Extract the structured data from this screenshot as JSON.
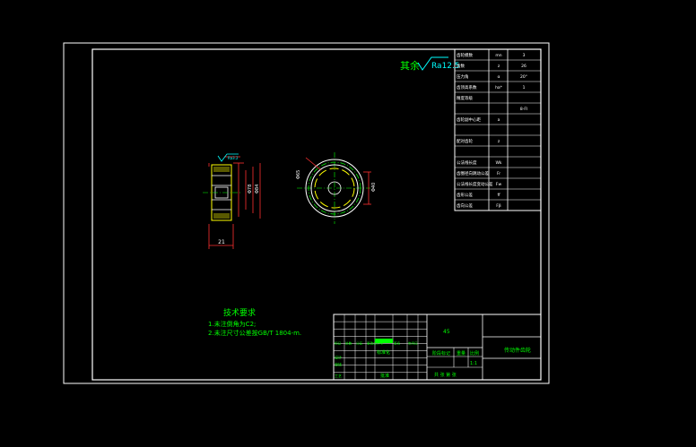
{
  "roughness": {
    "prefix": "其余",
    "value": "Ra12.5"
  },
  "tech_requirements": {
    "title": "技术要求",
    "items": [
      "1.未注倒角为C2;",
      "2.未注尺寸公差按GB/T 1804-m."
    ]
  },
  "params_table": {
    "rows": [
      {
        "name": "齿轮模数",
        "symbol": "mn",
        "value": "3"
      },
      {
        "name": "齿数",
        "symbol": "z",
        "value": "26"
      },
      {
        "name": "压力角",
        "symbol": "α",
        "value": "20°"
      },
      {
        "name": "齿顶高系数",
        "symbol": "ha*",
        "value": "1"
      },
      {
        "name": "精度等级",
        "symbol": "",
        "value": ""
      },
      {
        "name": "",
        "symbol": "",
        "value": "8-Fl"
      },
      {
        "name": "齿轮副中心距",
        "symbol": "a",
        "value": ""
      },
      {
        "name": "",
        "symbol": "",
        "value": ""
      },
      {
        "name": "配对齿轮",
        "symbol": "z",
        "value": ""
      },
      {
        "name": "",
        "symbol": "",
        "value": ""
      },
      {
        "name": "公法线长度",
        "symbol": "Wk",
        "value": ""
      },
      {
        "name": "齿圈径向跳动公差",
        "symbol": "Fr",
        "value": ""
      },
      {
        "name": "公法线长度变动公差",
        "symbol": "Fw",
        "value": ""
      },
      {
        "name": "齿形公差",
        "symbol": "ff",
        "value": ""
      },
      {
        "name": "齿向公差",
        "symbol": "Fβ",
        "value": ""
      }
    ]
  },
  "dimensions": {
    "width": "21"
  },
  "title_block": {
    "material": "45",
    "part_name": "传动件齿轮",
    "headers": [
      "标记",
      "处数",
      "分区",
      "更改文件号",
      "签名",
      "年月日"
    ],
    "rows": [
      "设计",
      "审核",
      "工艺"
    ],
    "stage": "阶段标记",
    "weight": "重量",
    "scale": "比例",
    "scale_value": "1:1",
    "sheet": "共 张 第 张",
    "std": "标准化",
    "approve": "批准"
  },
  "colors": {
    "background": "#000000",
    "frame": "#ffffff",
    "table_text": "#ffffff",
    "table_red": "#ff2020",
    "green": "#00ff00",
    "cyan": "#00ffff",
    "part_body": "#ffff00",
    "dimension": "#ff3030"
  }
}
